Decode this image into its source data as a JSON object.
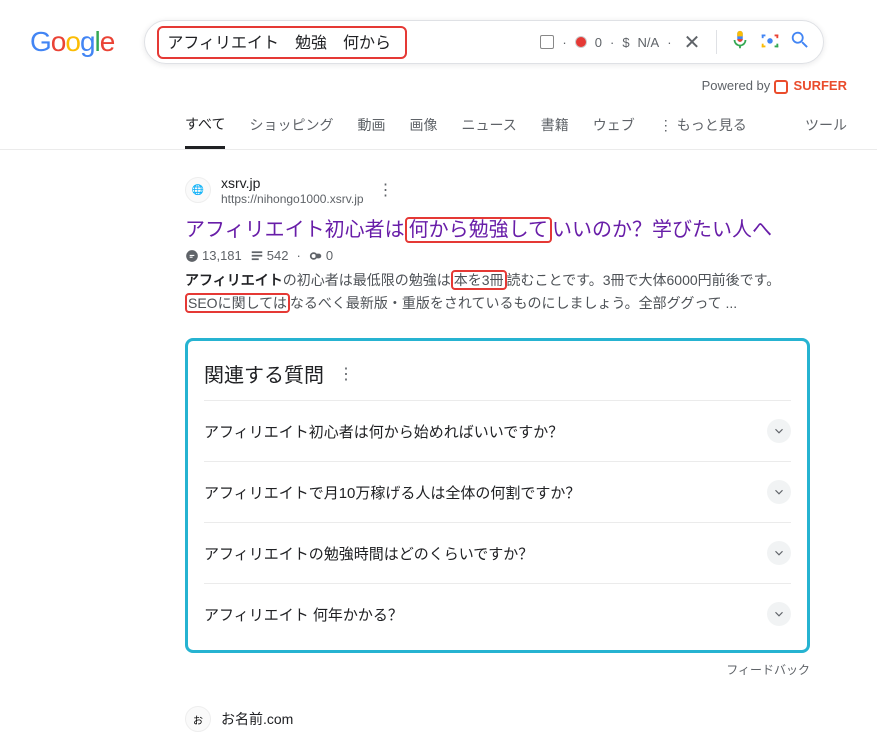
{
  "search": {
    "query": "アフィリエイト　勉強　何から",
    "jp_count": "0",
    "dollar": "$",
    "na": "N/A"
  },
  "powered": {
    "label": "Powered by",
    "brand": "SURFER"
  },
  "nav": {
    "all": "すべて",
    "shopping": "ショッピング",
    "video": "動画",
    "image": "画像",
    "news": "ニュース",
    "books": "書籍",
    "web": "ウェブ",
    "more": "もっと見る",
    "tools": "ツール"
  },
  "result1": {
    "site": "xsrv.jp",
    "url": "https://nihongo1000.xsrv.jp",
    "title_pre": "アフィリエイト初心者は",
    "title_hl": "何から勉強して",
    "title_post": "いいのか？学びたい人へ",
    "stats": {
      "comments": "13,181",
      "words": "542",
      "links": "0"
    },
    "snippet_bold": "アフィリエイト",
    "snippet_p1": "の初心者は最低限の勉強は",
    "snippet_hl1": "本を3冊",
    "snippet_p2": "読むことです。3冊で大体6000円前後です。",
    "snippet_hl2": "SEOに関しては",
    "snippet_p3": "なるべく最新版・重版をされているものにしましょう。全部ググって ..."
  },
  "paa": {
    "title": "関連する質問",
    "q1": "アフィリエイト初心者は何から始めればいいですか？",
    "q2": "アフィリエイトで月10万稼げる人は全体の何割ですか？",
    "q3": "アフィリエイトの勉強時間はどのくらいですか？",
    "q4": "アフィリエイト 何年かかる？"
  },
  "feedback": "フィードバック",
  "result2": {
    "site": "お名前.com"
  }
}
